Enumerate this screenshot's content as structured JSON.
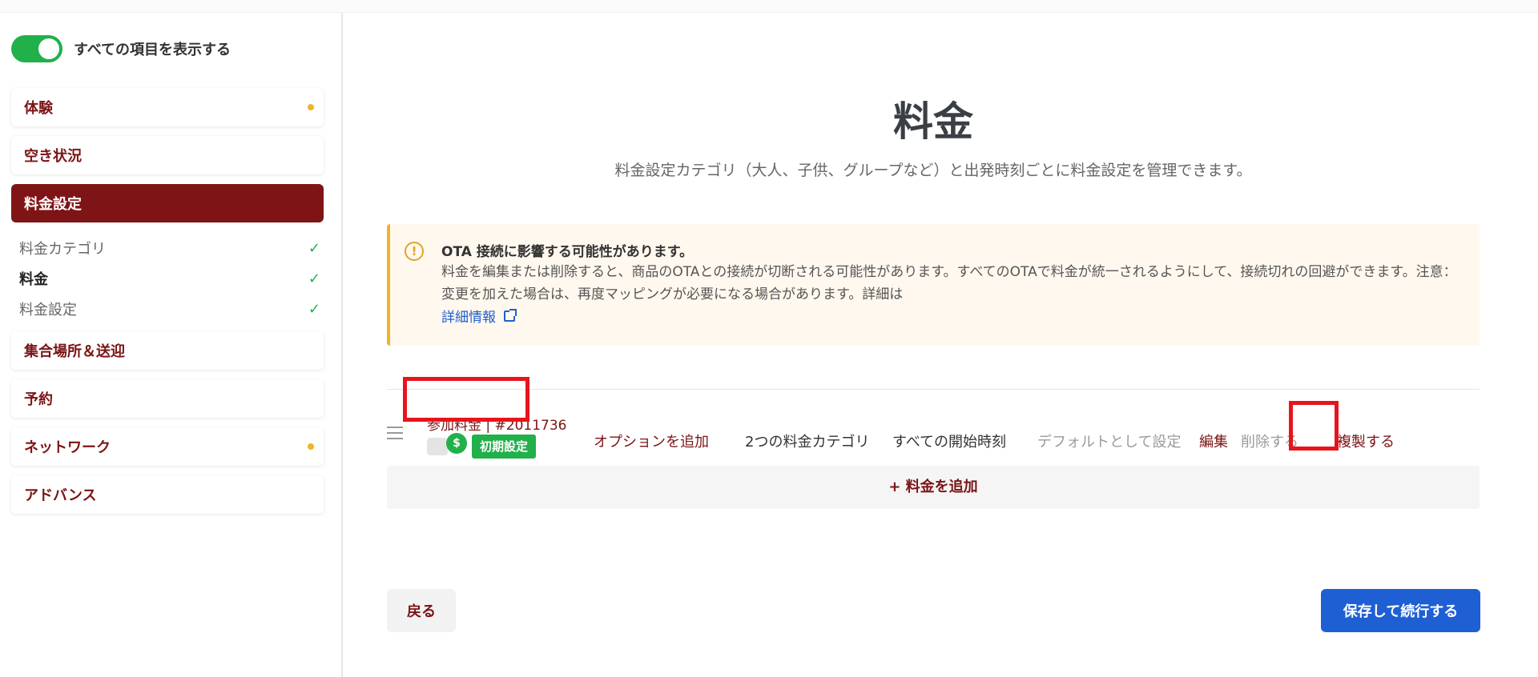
{
  "sidebar": {
    "toggle_label": "すべての項目を表示する",
    "items": [
      {
        "label": "体験"
      },
      {
        "label": "空き状況"
      },
      {
        "label": "料金設定"
      },
      {
        "label": "集合場所＆送迎"
      },
      {
        "label": "予約"
      },
      {
        "label": "ネットワーク"
      },
      {
        "label": "アドバンス"
      }
    ],
    "sub_items": [
      {
        "label": "料金カテゴリ"
      },
      {
        "label": "料金"
      },
      {
        "label": "料金設定"
      }
    ]
  },
  "main": {
    "title": "料金",
    "subtitle": "料金設定カテゴリ（大人、子供、グループなど）と出発時刻ごとに料金設定を管理できます。",
    "alert": {
      "title": "OTA 接続に影響する可能性があります。",
      "body": "料金を編集または削除すると、商品のOTAとの接続が切断される可能性があります。すべてのOTAで料金が統一されるようにして、接続切れの回避ができます。注意：変更を加えた場合は、再度マッピングが必要になる場合があります。詳細は",
      "link": "詳細情報"
    },
    "rate": {
      "name": "参加料金 | #2011736",
      "badge": "初期設定",
      "money_symbol": "$",
      "add_option": "オプションを追加",
      "categories": "2つの料金カテゴリ",
      "times": "すべての開始時刻",
      "set_default": "デフォルトとして設定",
      "edit": "編集",
      "delete": "削除する",
      "duplicate": "複製する"
    },
    "add_rate": "+ 料金を追加",
    "back": "戻る",
    "save": "保存して続行する"
  },
  "colors": {
    "brand": "#7f1416",
    "primary_button": "#1e5fd3",
    "success": "#22b04b",
    "warning": "#f0b429",
    "annotation": "#e8141c"
  }
}
